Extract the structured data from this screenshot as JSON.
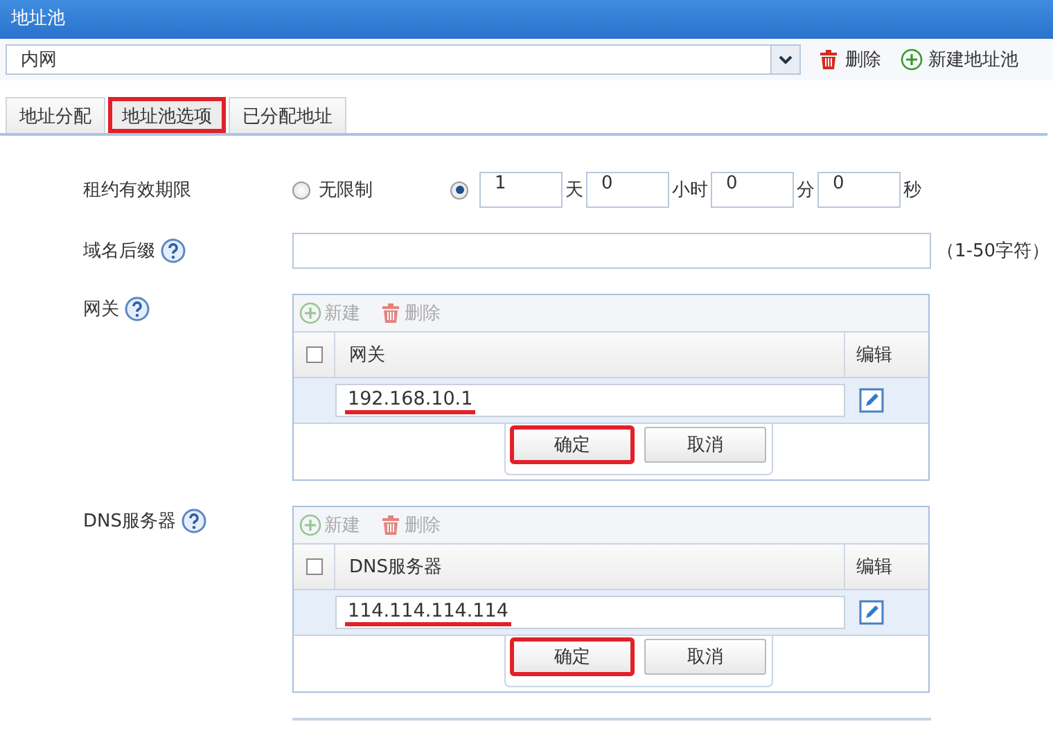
{
  "window": {
    "title": "地址池"
  },
  "pool_select": {
    "value": "内网"
  },
  "toolbar": [
    {
      "kind": "delete",
      "label": "删除"
    },
    {
      "kind": "add",
      "label": "新建地址池"
    }
  ],
  "tabs": [
    {
      "label": "地址分配",
      "selected": false,
      "highlighted": false
    },
    {
      "label": "地址池选项",
      "selected": true,
      "highlighted": true
    },
    {
      "label": "已分配地址",
      "selected": false,
      "highlighted": false
    }
  ],
  "lease": {
    "label": "租约有效期限",
    "unlimited": {
      "label": "无限制",
      "selected": false
    },
    "custom": {
      "selected": true
    },
    "fields": [
      {
        "value": "1",
        "unit": "天"
      },
      {
        "value": "0",
        "unit": "小时"
      },
      {
        "value": "0",
        "unit": "分"
      },
      {
        "value": "0",
        "unit": "秒"
      }
    ]
  },
  "domain": {
    "label": "域名后缀",
    "help": true,
    "hint": "（1-50字符）"
  },
  "tables": [
    {
      "label": "网关",
      "help": true,
      "actions": [
        {
          "kind": "add",
          "label": "新建",
          "disabled": true
        },
        {
          "kind": "delete",
          "label": "删除",
          "disabled": true
        }
      ],
      "header_checked": false,
      "column": "网关",
      "edit_column": "编辑",
      "value": "192.168.10.1",
      "value_highlighted": true,
      "buttons": [
        {
          "label": "确定",
          "highlighted": true
        },
        {
          "label": "取消",
          "highlighted": false
        }
      ]
    },
    {
      "label": "DNS服务器",
      "help": true,
      "actions": [
        {
          "kind": "add",
          "label": "新建",
          "disabled": true
        },
        {
          "kind": "delete",
          "label": "删除",
          "disabled": true
        }
      ],
      "header_checked": false,
      "column": "DNS服务器",
      "edit_column": "编辑",
      "value": "114.114.114.114",
      "value_highlighted": true,
      "buttons": [
        {
          "label": "确定",
          "highlighted": true
        },
        {
          "label": "取消",
          "highlighted": false
        }
      ]
    }
  ]
}
